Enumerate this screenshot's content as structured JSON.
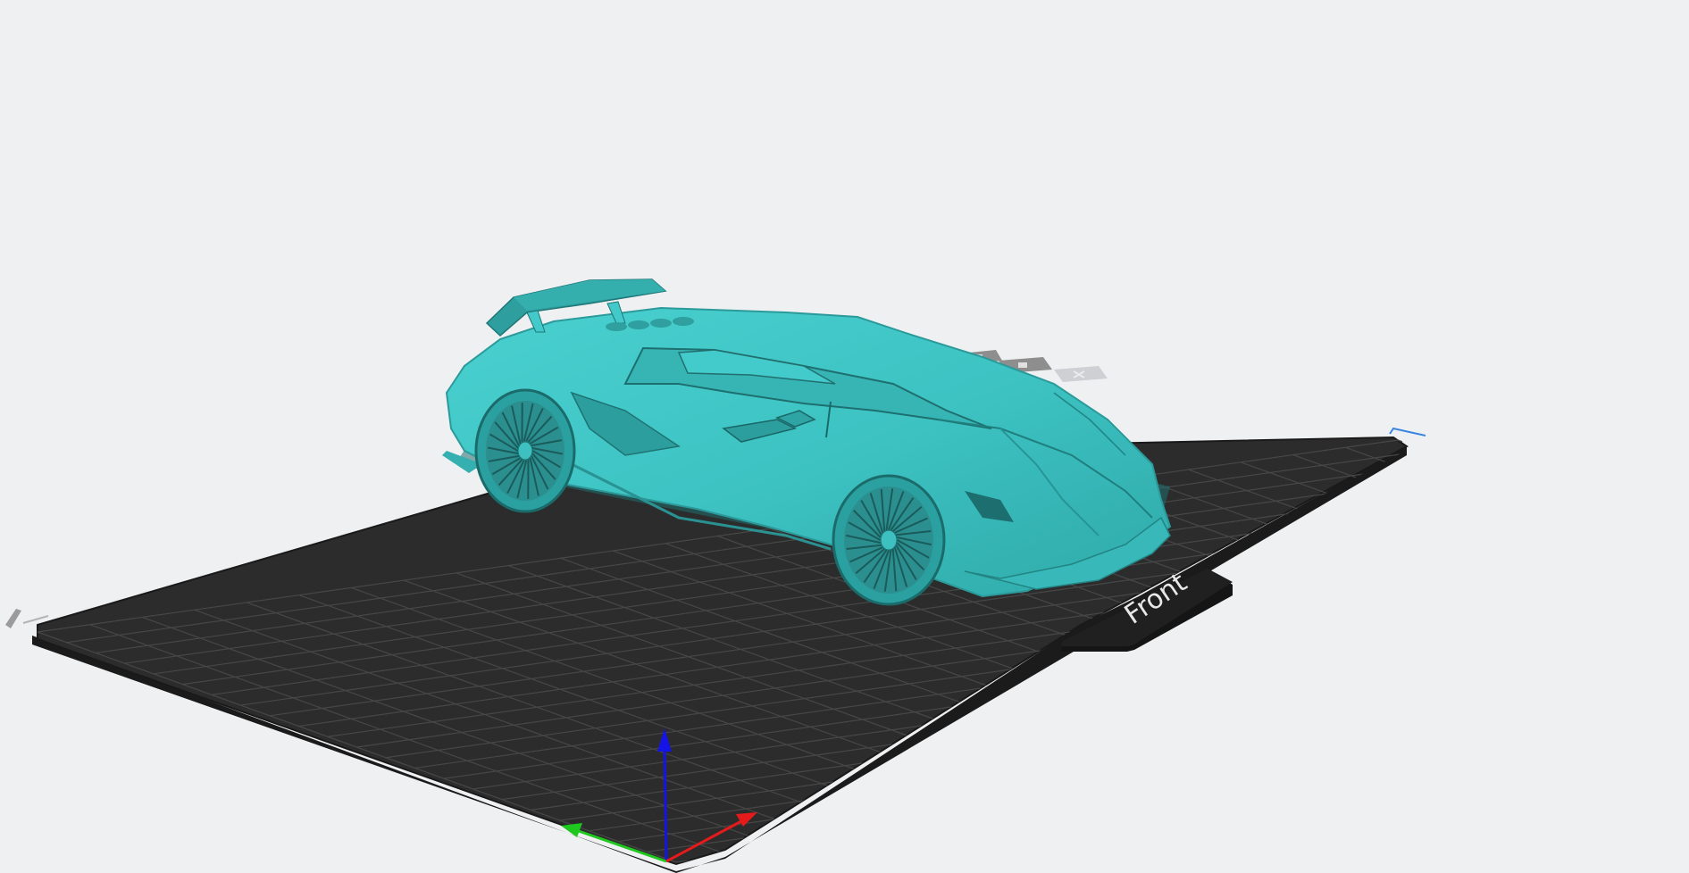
{
  "scene": {
    "bed_label": "Front",
    "background_color": "#eff0f2",
    "bed_color": "#2b2b2b",
    "grid_color": "#4a4a4a",
    "model_color": "#3ec3c3",
    "model_shadow_color": "#2a9c9c",
    "axis_colors": {
      "x": "#e51a1a",
      "y": "#1ec81e",
      "z": "#1414e6"
    },
    "icons": [
      "plate-icon",
      "plate-icon",
      "plate-icon",
      "close-icon",
      "mini-plate-icon",
      "corner-marker-icon"
    ]
  }
}
